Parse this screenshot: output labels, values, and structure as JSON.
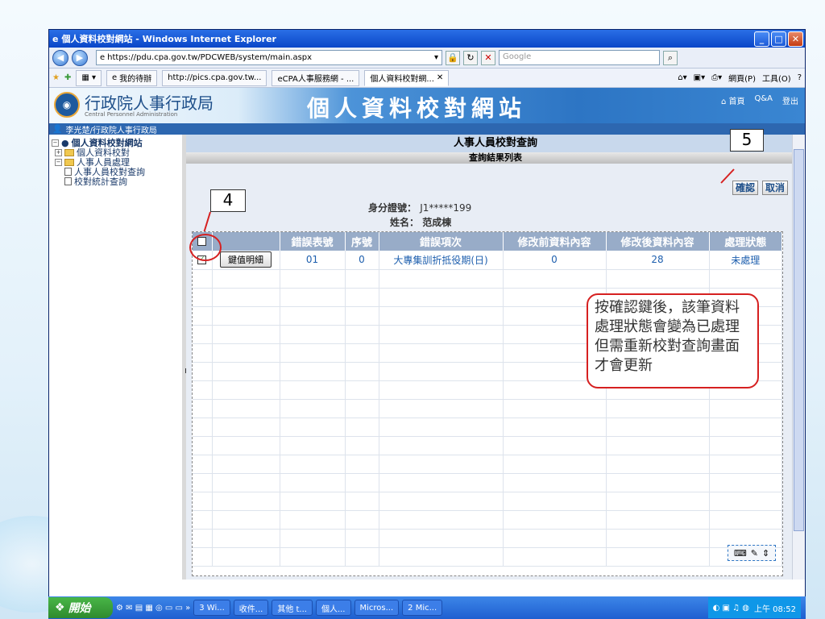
{
  "window": {
    "title": "個人資料校對網站 - Windows Internet Explorer",
    "min": "_",
    "max": "□",
    "close": "✕"
  },
  "address": {
    "url": "https://pdu.cpa.gov.tw/PDCWEB/system/main.aspx",
    "search_placeholder": "Google"
  },
  "favbar": {
    "mypending": "我的待辦",
    "tabs": [
      "http://pics.cpa.gov.tw...",
      "eCPA人事服務網 - ...",
      "個人資料校對網..."
    ],
    "cmds": [
      "網頁(P)",
      "工具(O)"
    ]
  },
  "header": {
    "org": "行政院人事行政局",
    "org_en": "Central Personnel Administration",
    "site": "個人資料校對網站",
    "links": [
      "首頁",
      "Q&A",
      "登出"
    ]
  },
  "userbar": {
    "user": "李光楚/行政院人事行政局"
  },
  "tree": {
    "root": "個人資料校對網站",
    "items": [
      {
        "label": "個人資料校對",
        "level": 1
      },
      {
        "label": "人事人員處理",
        "level": 1
      },
      {
        "label": "人事人員校對查詢",
        "level": 2
      },
      {
        "label": "校對統計查詢",
        "level": 2
      }
    ]
  },
  "main": {
    "title": "人事人員校對查詢",
    "subtitle": "查詢結果列表",
    "confirm": "確認",
    "cancel": "取消",
    "id_label": "身分證號：",
    "id_value": "J1*****199",
    "name_label": "姓名：",
    "name_value": "范成棟"
  },
  "table": {
    "headers": [
      "",
      "",
      "錯誤表號",
      "序號",
      "錯誤項次",
      "修改前資料內容",
      "修改後資料內容",
      "處理狀態"
    ],
    "rows": [
      {
        "checked": "✓",
        "btn": "鍵值明細",
        "form": "01",
        "seq": "0",
        "item": "大專集訓折抵役期(日)",
        "before": "0",
        "after": "28",
        "status": "未處理"
      }
    ]
  },
  "annotations": {
    "n4": "4",
    "n5": "5",
    "note": "按確認鍵後，該筆資料處理狀態會變為已處理但需重新校對查詢畫面才會更新"
  },
  "taskbar": {
    "start": "開始",
    "tasks": [
      "3 Wi...",
      "收件...",
      "其他 t...",
      "個人...",
      "Micros...",
      "2 Mic..."
    ],
    "clock": "上午 08:52"
  }
}
